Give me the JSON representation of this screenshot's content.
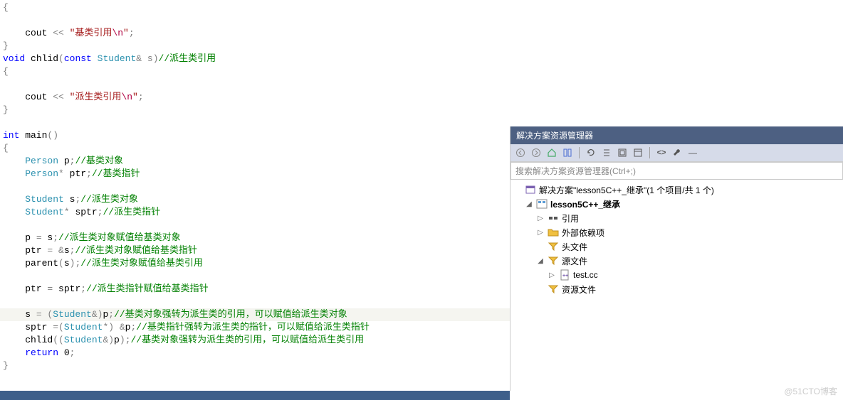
{
  "code": {
    "lines": [
      [
        {
          "c": "pn",
          "t": "{"
        }
      ],
      [
        {
          "c": "txt",
          "t": ""
        }
      ],
      [
        {
          "c": "txt",
          "t": "    cout "
        },
        {
          "c": "pn",
          "t": "<< "
        },
        {
          "c": "str",
          "t": "\"基类引用"
        },
        {
          "c": "strch",
          "t": "\\n"
        },
        {
          "c": "str",
          "t": "\""
        },
        {
          "c": "pn",
          "t": ";"
        }
      ],
      [
        {
          "c": "pn",
          "t": "}"
        }
      ],
      [
        {
          "c": "kw",
          "t": "void"
        },
        {
          "c": "txt",
          "t": " chlid"
        },
        {
          "c": "pn",
          "t": "("
        },
        {
          "c": "kw",
          "t": "const"
        },
        {
          "c": "txt",
          "t": " "
        },
        {
          "c": "typ",
          "t": "Student"
        },
        {
          "c": "pn",
          "t": "&"
        },
        {
          "c": "txt",
          "t": " "
        },
        {
          "c": "pn",
          "t": "s)"
        },
        {
          "c": "com",
          "t": "//派生类引用"
        }
      ],
      [
        {
          "c": "pn",
          "t": "{"
        }
      ],
      [
        {
          "c": "txt",
          "t": ""
        }
      ],
      [
        {
          "c": "txt",
          "t": "    cout "
        },
        {
          "c": "pn",
          "t": "<< "
        },
        {
          "c": "str",
          "t": "\"派生类引用"
        },
        {
          "c": "strch",
          "t": "\\n"
        },
        {
          "c": "str",
          "t": "\""
        },
        {
          "c": "pn",
          "t": ";"
        }
      ],
      [
        {
          "c": "pn",
          "t": "}"
        }
      ],
      [
        {
          "c": "txt",
          "t": ""
        }
      ],
      [
        {
          "c": "kw",
          "t": "int"
        },
        {
          "c": "txt",
          "t": " main"
        },
        {
          "c": "pn",
          "t": "()"
        }
      ],
      [
        {
          "c": "pn",
          "t": "{"
        }
      ],
      [
        {
          "c": "txt",
          "t": "    "
        },
        {
          "c": "typ",
          "t": "Person"
        },
        {
          "c": "txt",
          "t": " p"
        },
        {
          "c": "pn",
          "t": ";"
        },
        {
          "c": "com",
          "t": "//基类对象"
        }
      ],
      [
        {
          "c": "txt",
          "t": "    "
        },
        {
          "c": "typ",
          "t": "Person"
        },
        {
          "c": "pn",
          "t": "*"
        },
        {
          "c": "txt",
          "t": " ptr"
        },
        {
          "c": "pn",
          "t": ";"
        },
        {
          "c": "com",
          "t": "//基类指针"
        }
      ],
      [
        {
          "c": "txt",
          "t": ""
        }
      ],
      [
        {
          "c": "txt",
          "t": "    "
        },
        {
          "c": "typ",
          "t": "Student"
        },
        {
          "c": "txt",
          "t": " s"
        },
        {
          "c": "pn",
          "t": ";"
        },
        {
          "c": "com",
          "t": "//派生类对象"
        }
      ],
      [
        {
          "c": "txt",
          "t": "    "
        },
        {
          "c": "typ",
          "t": "Student"
        },
        {
          "c": "pn",
          "t": "*"
        },
        {
          "c": "txt",
          "t": " sptr"
        },
        {
          "c": "pn",
          "t": ";"
        },
        {
          "c": "com",
          "t": "//派生类指针"
        }
      ],
      [
        {
          "c": "txt",
          "t": ""
        }
      ],
      [
        {
          "c": "txt",
          "t": "    p "
        },
        {
          "c": "pn",
          "t": "="
        },
        {
          "c": "txt",
          "t": " s"
        },
        {
          "c": "pn",
          "t": ";"
        },
        {
          "c": "com",
          "t": "//派生类对象赋值给基类对象"
        }
      ],
      [
        {
          "c": "txt",
          "t": "    ptr "
        },
        {
          "c": "pn",
          "t": "= &"
        },
        {
          "c": "txt",
          "t": "s"
        },
        {
          "c": "pn",
          "t": ";"
        },
        {
          "c": "com",
          "t": "//派生类对象赋值给基类指针"
        }
      ],
      [
        {
          "c": "txt",
          "t": "    parent"
        },
        {
          "c": "pn",
          "t": "("
        },
        {
          "c": "txt",
          "t": "s"
        },
        {
          "c": "pn",
          "t": ");"
        },
        {
          "c": "com",
          "t": "//派生类对象赋值给基类引用"
        }
      ],
      [
        {
          "c": "txt",
          "t": ""
        }
      ],
      [
        {
          "c": "txt",
          "t": "    ptr "
        },
        {
          "c": "pn",
          "t": "="
        },
        {
          "c": "txt",
          "t": " sptr"
        },
        {
          "c": "pn",
          "t": ";"
        },
        {
          "c": "com",
          "t": "//派生类指针赋值给基类指针"
        }
      ],
      [
        {
          "c": "txt",
          "t": ""
        }
      ],
      [
        {
          "c": "txt",
          "t": "    s "
        },
        {
          "c": "pn",
          "t": "= ("
        },
        {
          "c": "typ",
          "t": "Student"
        },
        {
          "c": "pn",
          "t": "&)"
        },
        {
          "c": "txt",
          "t": "p"
        },
        {
          "c": "pn",
          "t": ";"
        },
        {
          "c": "com",
          "t": "//基类对象强转为派生类的引用，可以赋值给派生类对象"
        }
      ],
      [
        {
          "c": "txt",
          "t": "    sptr "
        },
        {
          "c": "pn",
          "t": "=("
        },
        {
          "c": "typ",
          "t": "Student"
        },
        {
          "c": "pn",
          "t": "*) &"
        },
        {
          "c": "txt",
          "t": "p"
        },
        {
          "c": "pn",
          "t": ";"
        },
        {
          "c": "com",
          "t": "//基类指针强转为派生类的指针，可以赋值给派生类指针"
        }
      ],
      [
        {
          "c": "txt",
          "t": "    chlid"
        },
        {
          "c": "pn",
          "t": "(("
        },
        {
          "c": "typ",
          "t": "Student"
        },
        {
          "c": "pn",
          "t": "&)"
        },
        {
          "c": "txt",
          "t": "p"
        },
        {
          "c": "pn",
          "t": ");"
        },
        {
          "c": "com",
          "t": "//基类对象强转为派生类的引用，可以赋值给派生类引用"
        }
      ],
      [
        {
          "c": "txt",
          "t": "    "
        },
        {
          "c": "kw",
          "t": "return"
        },
        {
          "c": "txt",
          "t": " "
        },
        {
          "c": "num",
          "t": "0"
        },
        {
          "c": "pn",
          "t": ";"
        }
      ],
      [
        {
          "c": "pn",
          "t": "}"
        }
      ]
    ],
    "highlight_index": 24
  },
  "panel": {
    "title": "解决方案资源管理器",
    "search_placeholder": "搜索解决方案资源管理器(Ctrl+;)",
    "solution_label": "解决方案\"lesson5C++_继承\"(1 个项目/共 1 个)",
    "project_label": "lesson5C++_继承",
    "nodes": {
      "references": "引用",
      "external": "外部依赖项",
      "headers": "头文件",
      "sources": "源文件",
      "testcc": "test.cc",
      "resources": "资源文件"
    }
  },
  "watermark": "@51CTO博客"
}
